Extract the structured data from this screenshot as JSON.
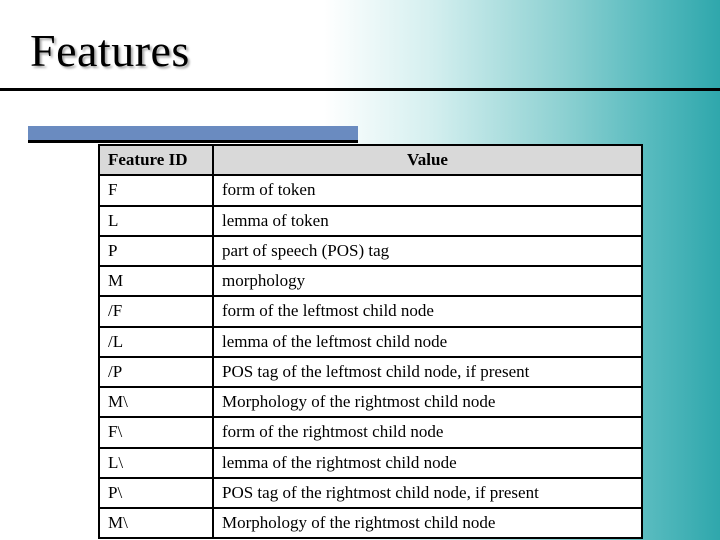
{
  "title": "Features",
  "table": {
    "headers": [
      "Feature ID",
      "Value"
    ],
    "rows": [
      {
        "id": "F",
        "value": "form of token"
      },
      {
        "id": "L",
        "value": "lemma of token"
      },
      {
        "id": "P",
        "value": "part of speech (POS) tag"
      },
      {
        "id": "M",
        "value": "morphology"
      },
      {
        "id": "/F",
        "value": "form of the leftmost child node"
      },
      {
        "id": "/L",
        "value": "lemma of the leftmost child node"
      },
      {
        "id": "/P",
        "value": "POS tag of the leftmost child node, if present"
      },
      {
        "id": "M\\",
        "value": "Morphology of the rightmost child node"
      },
      {
        "id": "F\\",
        "value": "form of the rightmost child node"
      },
      {
        "id": "L\\",
        "value": "lemma of the rightmost child node"
      },
      {
        "id": "P\\",
        "value": "POS tag of the rightmost child node, if present"
      },
      {
        "id": "M\\",
        "value": "Morphology of the rightmost child node"
      }
    ]
  }
}
